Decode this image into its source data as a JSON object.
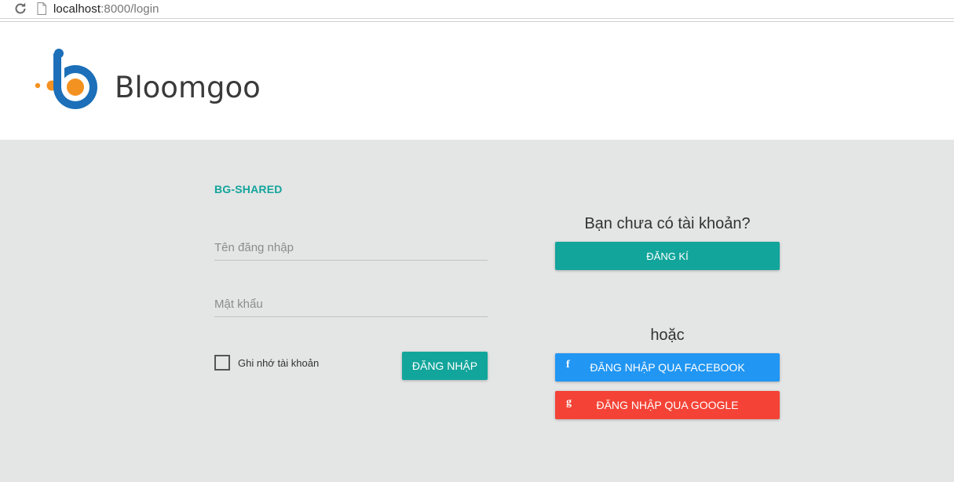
{
  "browser": {
    "url_host": "localhost",
    "url_rest": ":8000/login"
  },
  "header": {
    "logo_text": "Bloomgoo"
  },
  "login": {
    "brand_title": "BG-SHARED",
    "username_placeholder": "Tên đăng nhập",
    "password_placeholder": "Mật khẩu",
    "remember_label": "Ghi nhớ tài khoản",
    "login_button": "ĐĂNG NHẬP"
  },
  "signup": {
    "question": "Bạn chưa có tài khoản?",
    "register_button": "ĐĂNG KÍ",
    "or_text": "hoặc",
    "facebook_icon": "f",
    "facebook_button": "ĐĂNG NHẬP QUA FACEBOOK",
    "google_icon": "g",
    "google_button": "ĐĂNG NHẬP QUA GOOGLE"
  },
  "colors": {
    "accent": "#12a59b",
    "facebook": "#2196f3",
    "google": "#f44336",
    "logo_blue": "#1c6fb8",
    "logo_orange": "#f39220",
    "background": "#e4e5e5"
  },
  "icons": {
    "back": "back-arrow-icon",
    "reload": "reload-icon",
    "page": "page-icon"
  }
}
